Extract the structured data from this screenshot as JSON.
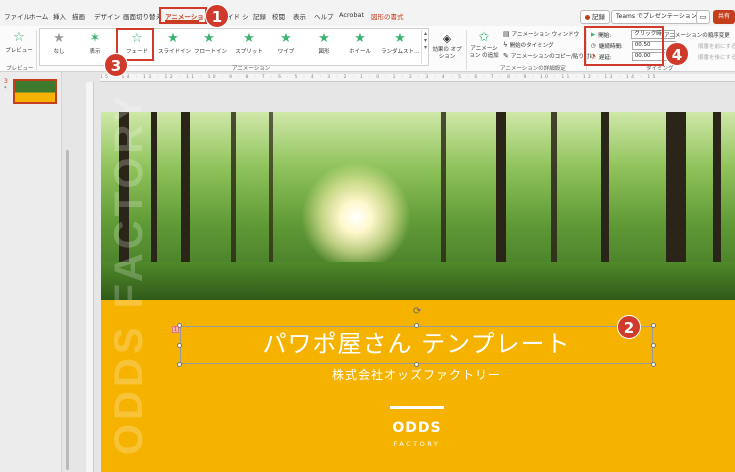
{
  "tabs": [
    "ファイル",
    "ホーム",
    "挿入",
    "描画",
    "デザイン",
    "画面切り替え",
    "アニメーション",
    "スライド ショー",
    "記録",
    "校閲",
    "表示",
    "ヘルプ",
    "Acrobat",
    "図形の書式"
  ],
  "active_tab": "アニメーション",
  "header_buttons": {
    "record": "記録",
    "teams": "Teams でプレゼンテーション",
    "share": "共有"
  },
  "ribbon": {
    "preview": "プレビュー",
    "preview_group": "プレビュー",
    "animations": [
      "なし",
      "表示",
      "フェード",
      "スライドイン",
      "フロートイン",
      "スプリット",
      "ワイプ",
      "図形",
      "ホイール",
      "ランダムスト..."
    ],
    "animation_group": "アニメーション",
    "effect_options": "効果の オプション",
    "add_animation": "アニメーション の追加",
    "pane": "アニメーション ウィンドウ",
    "trigger": "開始のタイミング",
    "painter": "アニメーションのコピー/貼り付け",
    "advanced_group": "アニメーションの詳細設定",
    "timing": {
      "start_label": "開始:",
      "start_value": "クリック時",
      "duration_label": "継続時間:",
      "duration_value": "00.50",
      "delay_label": "遅延:",
      "delay_value": "00.00",
      "reorder": "アニメーションの順序変更",
      "earlier": "順番を前にする",
      "later": "順番を後にする",
      "group": "タイミング"
    }
  },
  "badges": [
    "1",
    "2",
    "3",
    "4"
  ],
  "thumbnail": {
    "number": "3",
    "star": "*"
  },
  "slide": {
    "vertical_text": "ODDS FACTORY",
    "title": "パワポ屋さん テンプレート",
    "subtitle": "株式会社オッズファクトリー",
    "logo_line1": "ODDS",
    "logo_line2": "FACTORY",
    "anim_tag": "1"
  },
  "colors": {
    "accent": "#c43e1c",
    "highlight": "#d03a2a",
    "banner": "#f5b300"
  }
}
